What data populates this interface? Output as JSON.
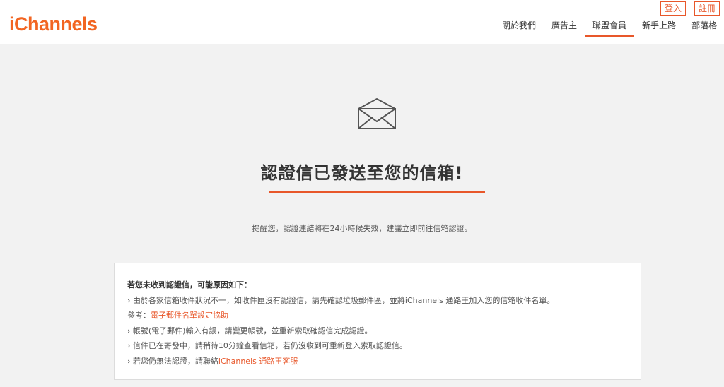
{
  "header": {
    "logo": "iChannels",
    "auth": {
      "login": "登入",
      "register": "註冊"
    },
    "nav": [
      {
        "label": "關於我們",
        "active": false
      },
      {
        "label": "廣告主",
        "active": false
      },
      {
        "label": "聯盟會員",
        "active": true
      },
      {
        "label": "新手上路",
        "active": false
      },
      {
        "label": "部落格",
        "active": false
      }
    ]
  },
  "main": {
    "icon": "envelope-icon",
    "title": "認證信已發送至您的信箱!",
    "hint": "提醒您，認證連結將在24小時候失效，建議立即前往信箱認證。"
  },
  "info_box": {
    "heading": "若您未收到認證信，可能原因如下：",
    "line1": "› 由於各家信箱收件狀況不一，如收件匣沒有認證信，請先確認垃圾郵件區，並將iChannels 通路王加入您的信箱收件名單。",
    "ref_prefix": "參考：",
    "ref_link": "電子郵件名單設定協助",
    "line2": "› 帳號(電子郵件)輸入有誤，請變更帳號，並重新索取確認信完成認證。",
    "line3": "› 信件已在寄發中，請稍待10分鐘查看信箱，若仍沒收到可重新登入索取認證信。",
    "line4_prefix": "› 若您仍無法認證，請聯絡",
    "line4_link": "iChannels 通路王客服"
  },
  "colors": {
    "accent": "#e8572a",
    "logo": "#f26522",
    "background": "#f2f2f2"
  }
}
